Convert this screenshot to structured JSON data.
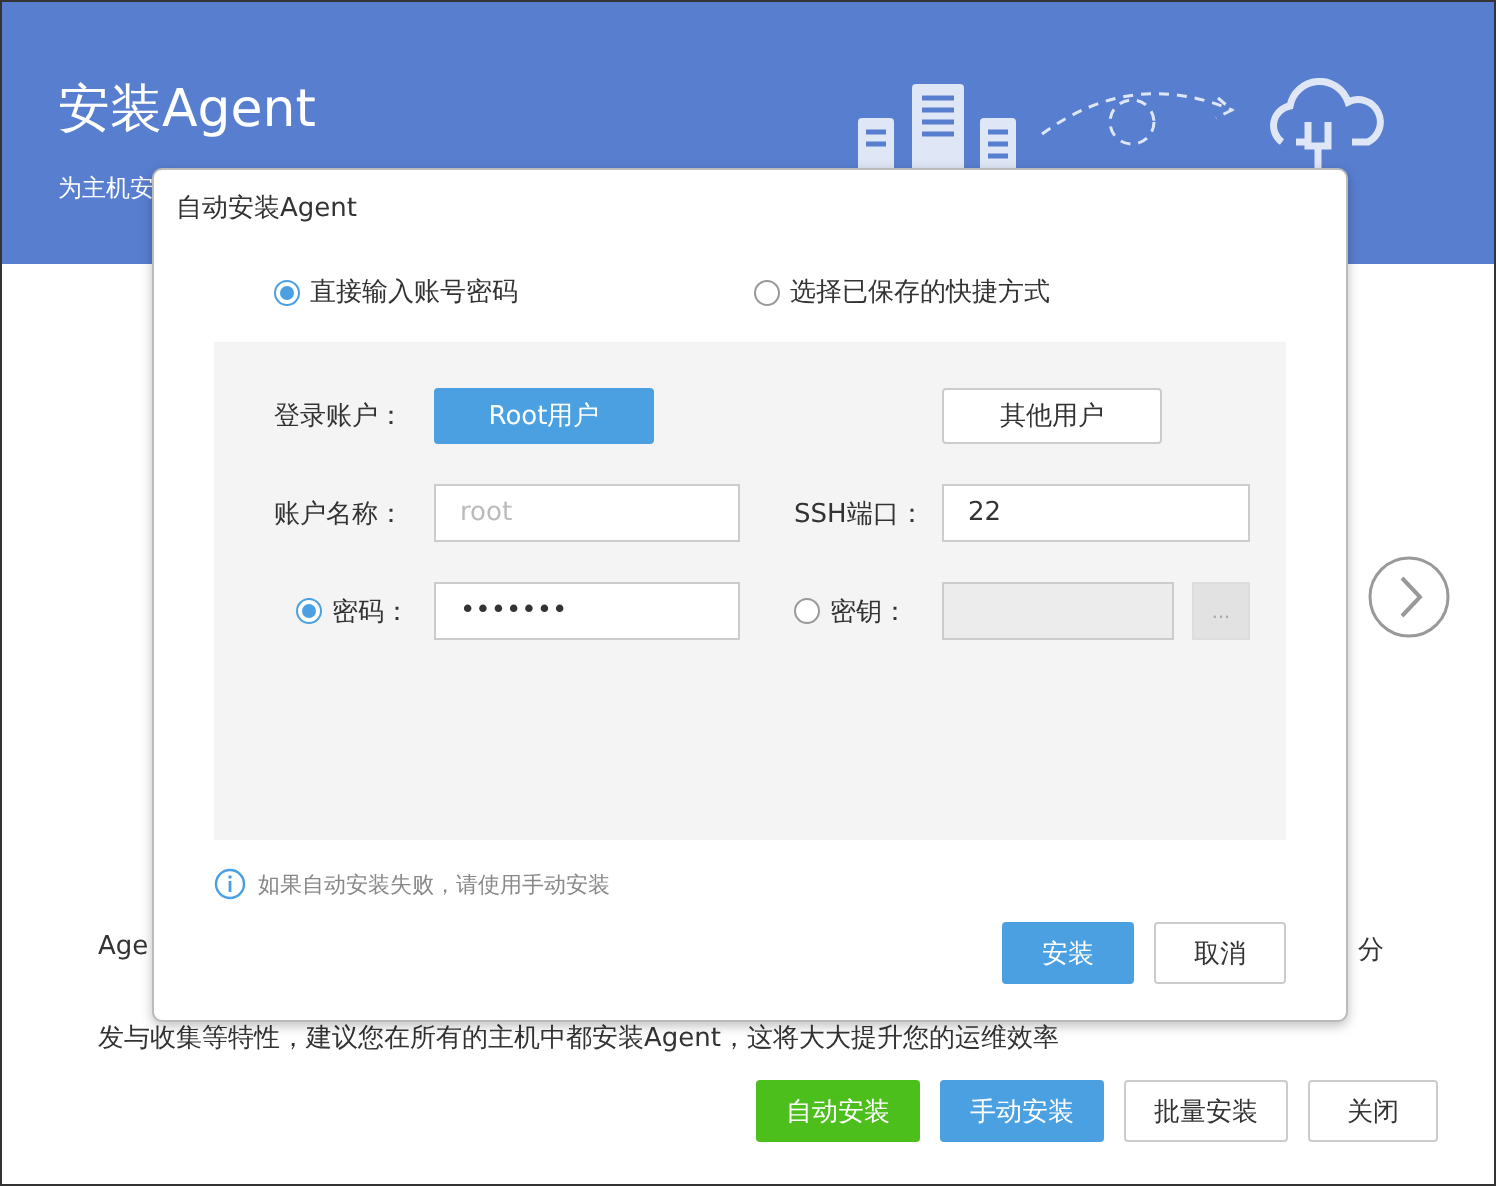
{
  "page": {
    "title": "安装Agent",
    "subtitle": "为主机安",
    "description": {
      "line_1_start": "Age",
      "line_1_end": "分",
      "line_2": "发与收集等特性，建议您在所有的主机中都安装Agent，这将大大提升您的运维效率"
    },
    "buttons": [
      {
        "label": "自动安装",
        "kind": "success"
      },
      {
        "label": "手动安装",
        "kind": "primary"
      },
      {
        "label": "批量安装",
        "kind": "default"
      },
      {
        "label": "关闭",
        "kind": "default"
      }
    ]
  },
  "dialog": {
    "title": "自动安装Agent",
    "modes": [
      {
        "label": "直接输入账号密码",
        "selected": true
      },
      {
        "label": "选择已保存的快捷方式",
        "selected": false
      }
    ],
    "login_account": {
      "label": "登录账户：",
      "options": [
        {
          "label": "Root用户",
          "selected": true
        },
        {
          "label": "其他用户",
          "selected": false
        }
      ]
    },
    "account_name": {
      "label": "账户名称：",
      "placeholder": "root"
    },
    "ssh_port": {
      "label": "SSH端口：",
      "value": "22"
    },
    "auth": [
      {
        "label": "密码：",
        "selected": true,
        "value": "•••••••"
      },
      {
        "label": "密钥：",
        "selected": false,
        "browse": "..."
      }
    ],
    "hint": "如果自动安装失败，请使用手动安装",
    "buttons": [
      {
        "label": "安装",
        "kind": "primary"
      },
      {
        "label": "取消",
        "kind": "default"
      }
    ]
  }
}
